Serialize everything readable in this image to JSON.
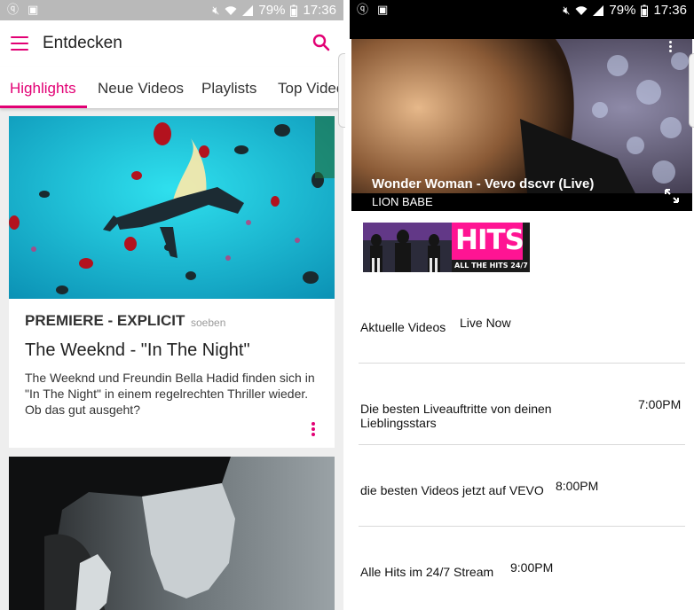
{
  "left": {
    "status_bar": {
      "battery": "79%",
      "time": "17:36"
    },
    "app_bar": {
      "title": "Entdecken"
    },
    "tabs": [
      {
        "label": "Highlights",
        "active": true
      },
      {
        "label": "Neue Videos",
        "active": false
      },
      {
        "label": "Playlists",
        "active": false
      },
      {
        "label": "Top Videos",
        "active": false
      }
    ],
    "card": {
      "label": "PREMIERE - EXPLICIT",
      "time": "soeben",
      "title": "The Weeknd - \"In The Night\"",
      "description": "The Weeknd und Freundin Bella Hadid finden sich in \"In The Night\" in einem regelrechten Thriller wieder. Ob das gut ausgeht?"
    }
  },
  "right": {
    "status_bar": {
      "battery": "79%",
      "time": "17:36"
    },
    "player": {
      "title": "Wonder Woman - Vevo dscvr (Live)",
      "artist": "LION BABE"
    },
    "banner": {
      "logo": "HITS",
      "tagline": "ALL THE HITS 24/7"
    },
    "schedule": [
      {
        "title": "Aktuelle Videos",
        "time": "Live Now"
      },
      {
        "title": "Die besten Liveauftritte von deinen Lieblingsstars",
        "time": "7:00PM"
      },
      {
        "title": "die besten Videos jetzt auf VEVO",
        "time": "8:00PM"
      },
      {
        "title": "Alle Hits im 24/7 Stream",
        "time": "9:00PM"
      }
    ]
  },
  "colors": {
    "accent": "#e20074",
    "hits_pink": "#ff1493"
  },
  "icons": [
    "menu-icon",
    "search-icon",
    "more-vert-icon",
    "expand-icon",
    "wifi-icon",
    "signal-icon",
    "battery-icon",
    "mute-icon"
  ]
}
